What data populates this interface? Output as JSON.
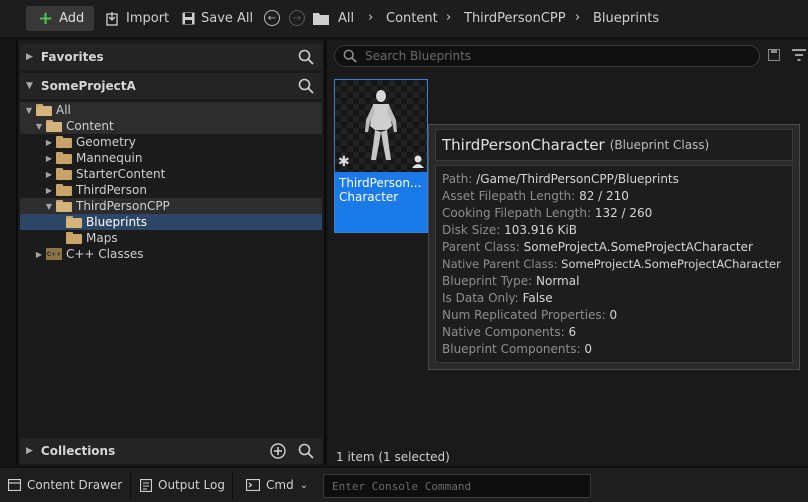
{
  "toolbar": {
    "add_label": "Add",
    "import_label": "Import",
    "save_all_label": "Save All",
    "breadcrumbs": [
      "All",
      "Content",
      "ThirdPersonCPP",
      "Blueprints"
    ],
    "icons": {
      "back": "arrow-left-circle-icon",
      "forward": "arrow-right-circle-icon",
      "folder": "folder-icon"
    }
  },
  "sidebar": {
    "favorites_label": "Favorites",
    "project_label": "SomeProjectA",
    "collections_label": "Collections",
    "tree": [
      {
        "label": "All",
        "level": 0,
        "expanded": true
      },
      {
        "label": "Content",
        "level": 1,
        "expanded": true
      },
      {
        "label": "Geometry",
        "level": 2,
        "expanded": false
      },
      {
        "label": "Mannequin",
        "level": 2,
        "expanded": false
      },
      {
        "label": "StarterContent",
        "level": 2,
        "expanded": false
      },
      {
        "label": "ThirdPerson",
        "level": 2,
        "expanded": false
      },
      {
        "label": "ThirdPersonCPP",
        "level": 2,
        "expanded": true
      },
      {
        "label": "Blueprints",
        "level": 3,
        "selected": true
      },
      {
        "label": "Maps",
        "level": 3
      },
      {
        "label": "C++ Classes",
        "level": 1,
        "expanded": false
      }
    ]
  },
  "content": {
    "search_placeholder": "Search Blueprints",
    "asset": {
      "label_line1": "ThirdPerson...",
      "label_line2": "Character"
    },
    "status": "1 item (1 selected)"
  },
  "tooltip": {
    "name": "ThirdPersonCharacter",
    "type": "(Blueprint Class)",
    "rows": [
      {
        "key": "Path:",
        "value": "/Game/ThirdPersonCPP/Blueprints"
      },
      {
        "key": "Asset Filepath Length:",
        "value": "82 / 210"
      },
      {
        "key": "Cooking Filepath Length:",
        "value": "132 / 260"
      },
      {
        "key": "Disk Size:",
        "value": "103.916 KiB"
      },
      {
        "key": "Parent Class:",
        "value": "SomeProjectA.SomeProjectACharacter"
      },
      {
        "key": "Native Parent Class:",
        "value": "SomeProjectA.SomeProjectACharacter"
      },
      {
        "key": "Blueprint Type:",
        "value": "Normal"
      },
      {
        "key": "Is Data Only:",
        "value": "False"
      },
      {
        "key": "Num Replicated Properties:",
        "value": "0"
      },
      {
        "key": "Native Components:",
        "value": "6"
      },
      {
        "key": "Blueprint Components:",
        "value": "0"
      }
    ]
  },
  "bottom_bar": {
    "content_drawer": "Content Drawer",
    "output_log": "Output Log",
    "cmd": "Cmd",
    "console_placeholder": "Enter Console Command"
  },
  "colors": {
    "accent": "#1a7ae8",
    "selection": "#2c4766",
    "folder": "#c9a46a",
    "add_plus": "#4ec24e"
  }
}
